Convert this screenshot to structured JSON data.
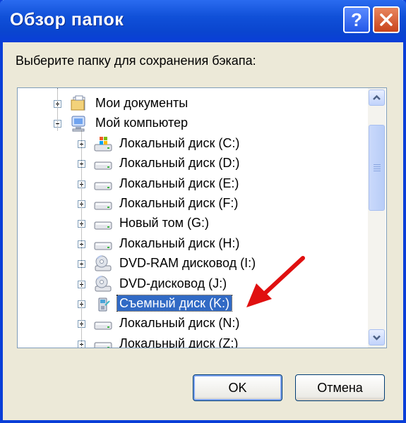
{
  "window": {
    "title": "Обзор папок"
  },
  "titlebar": {
    "help_label": "?"
  },
  "prompt": "Выберите папку для сохранения бэкапа:",
  "tree": {
    "items": [
      {
        "label": "Мои документы",
        "icon": "my-documents-icon",
        "expander": "plus",
        "level": 1
      },
      {
        "label": "Мой компьютер",
        "icon": "my-computer-icon",
        "expander": "minus",
        "level": 1
      },
      {
        "label": "Локальный диск (C:)",
        "icon": "system-drive-icon",
        "expander": "plus",
        "level": 2
      },
      {
        "label": "Локальный диск (D:)",
        "icon": "hard-drive-icon",
        "expander": "plus",
        "level": 2
      },
      {
        "label": "Локальный диск (E:)",
        "icon": "hard-drive-icon",
        "expander": "plus",
        "level": 2
      },
      {
        "label": "Локальный диск (F:)",
        "icon": "hard-drive-icon",
        "expander": "plus",
        "level": 2
      },
      {
        "label": "Новый том (G:)",
        "icon": "hard-drive-icon",
        "expander": "plus",
        "level": 2
      },
      {
        "label": "Локальный диск (H:)",
        "icon": "hard-drive-icon",
        "expander": "plus",
        "level": 2
      },
      {
        "label": "DVD-RAM дисковод (I:)",
        "icon": "dvd-drive-icon",
        "expander": "plus",
        "level": 2
      },
      {
        "label": "DVD-дисковод (J:)",
        "icon": "dvd-drive-icon",
        "expander": "plus",
        "level": 2
      },
      {
        "label": "Съемный диск (K:)",
        "icon": "removable-drive-icon",
        "expander": "plus",
        "level": 2,
        "selected": true
      },
      {
        "label": "Локальный диск (N:)",
        "icon": "hard-drive-icon",
        "expander": "plus",
        "level": 2
      },
      {
        "label": "Локальный диск (Z:)",
        "icon": "hard-drive-icon",
        "expander": "plus",
        "level": 2
      }
    ]
  },
  "buttons": {
    "ok": "OK",
    "cancel": "Отмена"
  },
  "colors": {
    "titlebar": "#0a3ed8",
    "selection": "#316ac5",
    "annotation_arrow": "#e01010",
    "dialog_bg": "#ece9d8"
  }
}
